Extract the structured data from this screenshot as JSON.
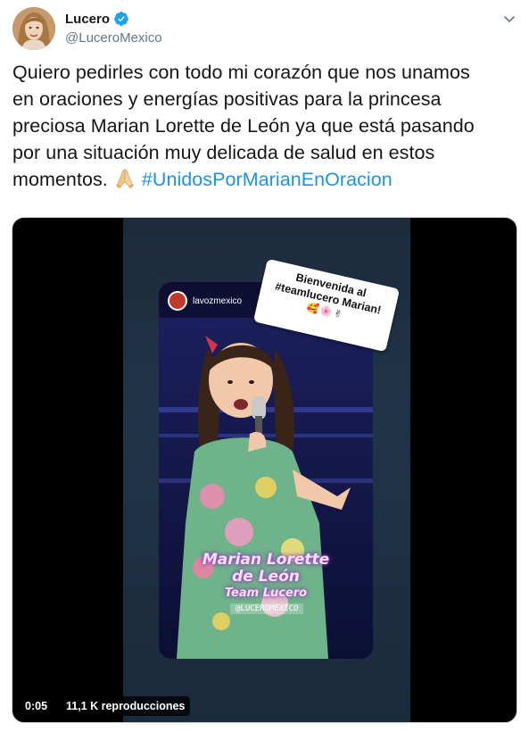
{
  "author": {
    "display_name": "Lucero",
    "handle": "@LuceroMexico",
    "verified": true,
    "avatar_icon": "profile-photo"
  },
  "menu_icon": "chevron-down-icon",
  "tweet": {
    "lines": [
      "Quiero pedirles con todo mi corazón que nos unamos",
      "en oraciones y energías positivas para la princesa",
      "preciosa Marian Lorette de León ya que está pasando",
      "por una situación muy delicada de salud en estos",
      "momentos."
    ],
    "emoji": "folded-hands",
    "hashtag": "#UnidosPorMarianEnOracion"
  },
  "media": {
    "story_username": "lavozmexico",
    "sticker": {
      "line1": "Bienvenida al",
      "line2": "#teamlucero Marian!",
      "emojis": "🥰🌸✌"
    },
    "overlay": {
      "name1": "Marian Lorette",
      "name2": "de León",
      "team": "Team Lucero",
      "handle": "@LUCEROMEXICO"
    },
    "timestamp": "0:05",
    "views": "11,1 K reproducciones"
  },
  "colors": {
    "link": "#1b95e0",
    "verified": "#1da1f2",
    "secondary_text": "#657786"
  }
}
